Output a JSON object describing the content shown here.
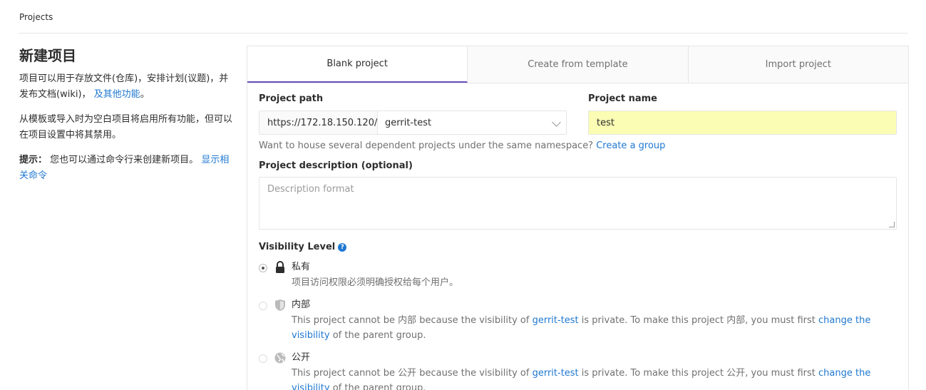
{
  "breadcrumb": "Projects",
  "sidebar": {
    "title": "新建项目",
    "p1_text": "项目可以用于存放文件(仓库)，安排计划(议题)，并发布文档(wiki)，",
    "p1_link": "及其他功能",
    "p1_end": "。",
    "p2": "从模板或导入时为空白项目将启用所有功能，但可以在项目设置中将其禁用。",
    "tip_label": "提示：",
    "tip_text": "您也可以通过命令行来创建新项目。",
    "tip_link": "显示相关命令"
  },
  "tabs": [
    {
      "label": "Blank project"
    },
    {
      "label": "Create from template"
    },
    {
      "label": "Import project"
    }
  ],
  "form": {
    "path_label": "Project path",
    "path_prefix": "https://172.18.150.120/",
    "path_namespace": "gerrit-test",
    "name_label": "Project name",
    "name_value": "test",
    "help_text": "Want to house several dependent projects under the same namespace?",
    "help_link": "Create a group",
    "desc_label": "Project description (optional)",
    "desc_placeholder": "Description format",
    "visibility_label": "Visibility Level"
  },
  "visibility": [
    {
      "title": "私有",
      "desc": "项目访问权限必须明确授权给每个用户。"
    },
    {
      "title": "内部",
      "d1": "This project cannot be 内部 because the visibility of ",
      "link1": "gerrit-test",
      "d2": " is private. To make this project 内部, you must first ",
      "link2": "change the visibility",
      "d3": " of the parent group."
    },
    {
      "title": "公开",
      "d1": "This project cannot be 公开 because the visibility of ",
      "link1": "gerrit-test",
      "d2": " is private. To make this project 公开, you must first ",
      "link2": "change the visibility",
      "d3": " of the parent group."
    }
  ],
  "colors": {
    "accent": "#6b4fbb",
    "link": "#1f78d1",
    "highlight": "#fafdb3"
  }
}
